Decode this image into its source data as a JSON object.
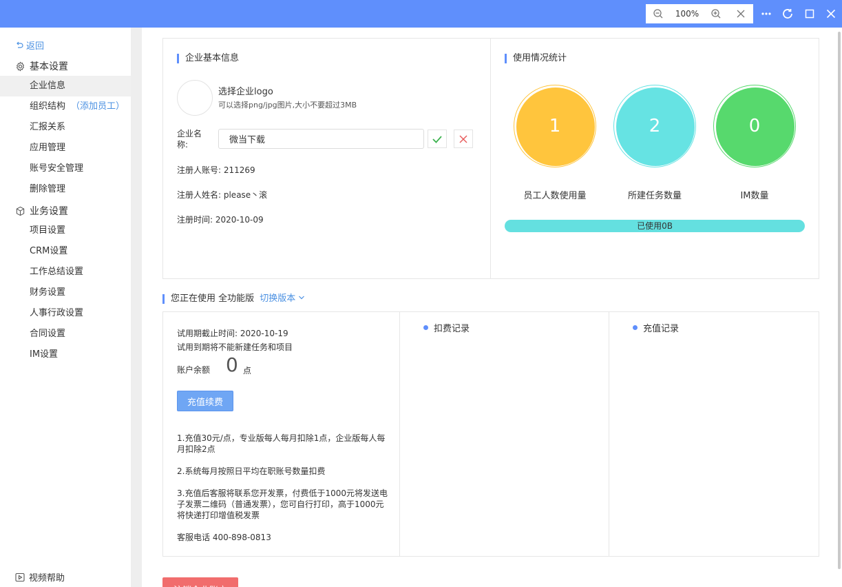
{
  "toolbar": {
    "zoom": "100%",
    "zoom_out_icon": "zoom-out-icon",
    "zoom_in_icon": "zoom-in-icon",
    "close_zoom_icon": "close-icon",
    "more_icon": "more-icon",
    "refresh_icon": "refresh-icon",
    "window_icon": "window-icon",
    "close_icon": "close-icon"
  },
  "sidebar": {
    "back": "返回",
    "groups": [
      {
        "label": "基本设置",
        "icon": "gear-icon"
      },
      {
        "label": "业务设置",
        "icon": "cube-icon"
      }
    ],
    "basic_items": [
      {
        "label": "企业信息"
      },
      {
        "label": "组织结构",
        "extra": "（添加员工）"
      },
      {
        "label": "汇报关系"
      },
      {
        "label": "应用管理"
      },
      {
        "label": "账号安全管理"
      },
      {
        "label": "删除管理"
      }
    ],
    "business_items": [
      {
        "label": "项目设置"
      },
      {
        "label": "CRM设置"
      },
      {
        "label": "工作总结设置"
      },
      {
        "label": "财务设置"
      },
      {
        "label": "人事行政设置"
      },
      {
        "label": "合同设置"
      },
      {
        "label": "IM设置"
      }
    ],
    "help": "视频帮助"
  },
  "company": {
    "title": "企业基本信息",
    "logo_title": "选择企业logo",
    "logo_hint": "可以选择png/jpg图片,大小不要超过3MB",
    "name_label_line1": "企业名",
    "name_label_line2": "称:",
    "name_value": "微当下载",
    "account": "注册人账号:  211269",
    "owner_name": "注册人姓名:  please丶滚",
    "reg_time": "注册时间:  2020-10-09"
  },
  "usage": {
    "title": "使用情况统计",
    "stats": [
      {
        "value": "1",
        "label": "员工人数使用量",
        "color": "#ffc53d"
      },
      {
        "value": "2",
        "label": "所建任务数量",
        "color": "#66e3e3"
      },
      {
        "value": "0",
        "label": "IM数量",
        "color": "#57d96d"
      }
    ],
    "storage": "已使用0B"
  },
  "version": {
    "prefix": "您正在使用 全功能版",
    "switch": "切换版本"
  },
  "billing": {
    "trial_end": "试用期截止时间:  2020-10-19",
    "trial_note": "试用到期将不能新建任务和项目",
    "balance_label": "账户余额",
    "balance": "0",
    "balance_unit": "点",
    "recharge": "充值续费",
    "notes": [
      "1.充值30元/点，专业版每人每月扣除1点，企业版每人每月扣除2点",
      "2.系统每月按照日平均在职账号数量扣费",
      "3.充值后客服将联系您开发票，付费低于1000元将发送电子发票二维码（普通发票），您可自行打印，高于1000元将快递打印增值税发票",
      "客服电话 400-898-0813"
    ],
    "deduct_records": "扣费记录",
    "recharge_records": "充值记录"
  },
  "danger": {
    "deregister": "注销企业账户"
  }
}
